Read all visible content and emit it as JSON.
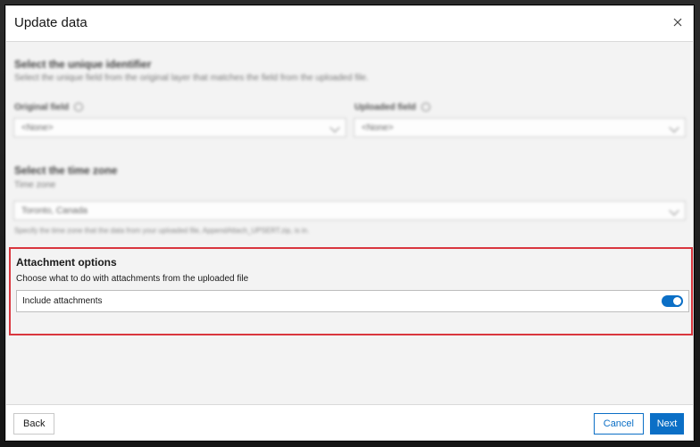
{
  "dialog": {
    "title": "Update data",
    "close_label": "×"
  },
  "unique_identifier": {
    "heading": "Select the unique identifier",
    "description": "Select the unique field from the original layer that matches the field from the uploaded file.",
    "original_field": {
      "label": "Original field",
      "value": "<None>"
    },
    "uploaded_field": {
      "label": "Uploaded field",
      "value": "<None>"
    }
  },
  "time_zone": {
    "heading": "Select the time zone",
    "label": "Time zone",
    "value": "Toronto, Canada",
    "hint": "Specify the time zone that the data from your uploaded file, AppendAttach_UPSERT.zip, is in."
  },
  "attachment_options": {
    "heading": "Attachment options",
    "description": "Choose what to do with attachments from the uploaded file",
    "toggle_label": "Include attachments",
    "toggle_on": true
  },
  "footer": {
    "back_label": "Back",
    "cancel_label": "Cancel",
    "next_label": "Next"
  },
  "colors": {
    "accent": "#0b6fc6",
    "highlight": "#d9363e"
  }
}
